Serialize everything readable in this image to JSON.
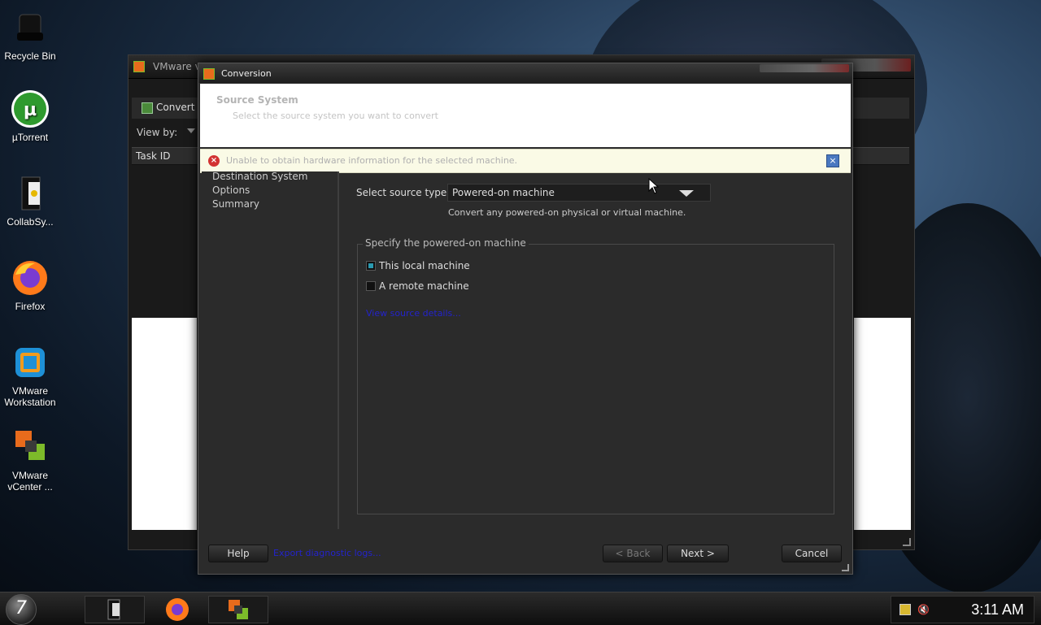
{
  "desktop": {
    "icons": [
      {
        "label": "Recycle Bin",
        "icon": "recycle-bin-icon"
      },
      {
        "label": "µTorrent",
        "icon": "utorrent-icon"
      },
      {
        "label": "CollabSy...",
        "icon": "collabsync-icon"
      },
      {
        "label": "Firefox",
        "icon": "firefox-icon"
      },
      {
        "label": "VMware Workstation",
        "icon": "vmware-workstation-icon"
      },
      {
        "label": "VMware vCenter ...",
        "icon": "vmware-vcenter-icon"
      }
    ]
  },
  "back_window": {
    "title": "VMware vC",
    "toolbar_button": "Convert m",
    "view_by_label": "View by:",
    "column_header": "Task ID"
  },
  "dialog": {
    "title": "Conversion",
    "header_title": "Source System",
    "header_subtitle": "Select the source system you want to convert",
    "error_message": "Unable to obtain hardware information for the selected machine.",
    "nav_items": [
      "Destination System",
      "Options",
      "Summary"
    ],
    "source_type_label": "Select source type:",
    "source_type_value": "Powered-on machine",
    "source_type_hint": "Convert any powered-on physical or virtual machine.",
    "group_legend": "Specify the powered-on machine",
    "options": [
      {
        "label": "This local machine",
        "selected": true
      },
      {
        "label": "A remote machine",
        "selected": false
      }
    ],
    "view_details_link": "View source details...",
    "buttons": {
      "help": "Help",
      "export_logs": "Export diagnostic logs...",
      "back": "< Back",
      "next": "Next >",
      "cancel": "Cancel"
    }
  },
  "taskbar": {
    "clock": "3:11 AM",
    "pinned": [
      "collabsync-icon",
      "firefox-icon",
      "vmware-vcenter-icon"
    ]
  },
  "colors": {
    "error_red": "#d23232",
    "link_blue": "#2323cc",
    "selection_teal": "#2a9ab0"
  }
}
